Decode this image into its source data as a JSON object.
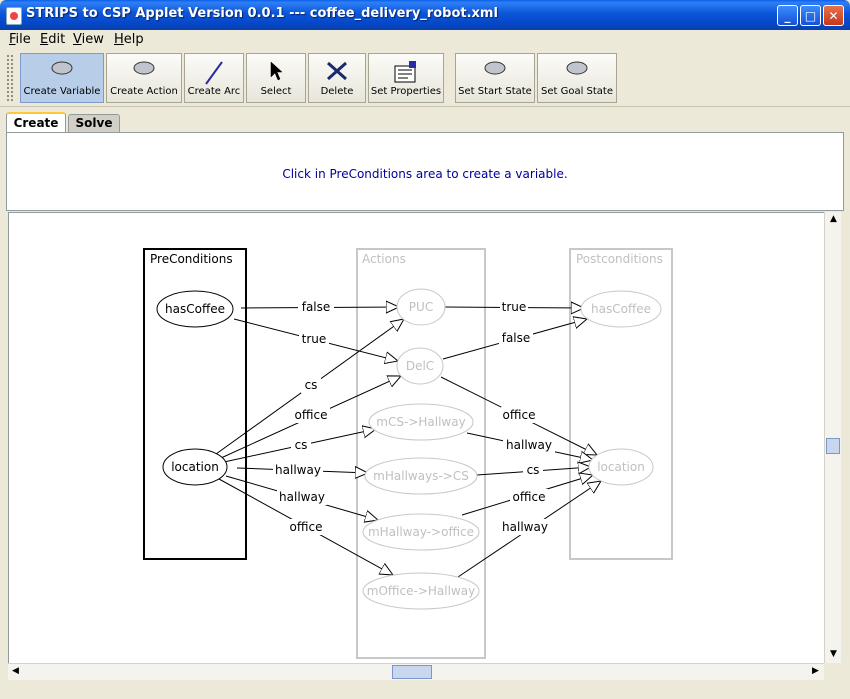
{
  "window": {
    "title": "STRIPS to CSP Applet Version 0.0.1 --- coffee_delivery_robot.xml",
    "minimize_glyph": "_",
    "maximize_glyph": "□",
    "close_glyph": "✕"
  },
  "menu": [
    {
      "mnemonic": "F",
      "rest": "ile"
    },
    {
      "mnemonic": "E",
      "rest": "dit"
    },
    {
      "mnemonic": "V",
      "rest": "iew"
    },
    {
      "mnemonic": "H",
      "rest": "elp"
    }
  ],
  "toolbar": {
    "buttons": [
      {
        "label": "Create Variable",
        "icon": "ellipse-icon",
        "selected": true
      },
      {
        "label": "Create Action",
        "icon": "ellipse-icon",
        "selected": false
      },
      {
        "label": "Create Arc",
        "icon": "line-icon",
        "selected": false
      },
      {
        "label": "Select",
        "icon": "cursor-icon",
        "selected": false
      },
      {
        "label": "Delete",
        "icon": "delete-x-icon",
        "selected": false
      },
      {
        "label": "Set Properties",
        "icon": "properties-icon",
        "selected": false
      },
      {
        "label": "Set Start State",
        "icon": "ellipse-icon",
        "selected": false
      },
      {
        "label": "Set Goal State",
        "icon": "ellipse-icon",
        "selected": false
      }
    ]
  },
  "tabs": [
    {
      "label": "Create",
      "active": true
    },
    {
      "label": "Solve",
      "active": false
    }
  ],
  "message": "Click in PreConditions area to create a variable.",
  "graph": {
    "columns": {
      "preconditions": "PreConditions",
      "actions": "Actions",
      "postconditions": "Postconditions"
    },
    "pre_nodes": [
      "hasCoffee",
      "location"
    ],
    "action_nodes": [
      "PUC",
      "DelC",
      "mCS->Hallway",
      "mHallways->CS",
      "mHallway->office",
      "mOffice->Hallway"
    ],
    "post_nodes": [
      "hasCoffee",
      "location"
    ],
    "pre_edges": [
      {
        "from": "hasCoffee",
        "to": "PUC",
        "label": "false"
      },
      {
        "from": "hasCoffee",
        "to": "DelC",
        "label": "true"
      },
      {
        "from": "location",
        "to": "PUC",
        "label": "cs"
      },
      {
        "from": "location",
        "to": "DelC",
        "label": "office"
      },
      {
        "from": "location",
        "to": "mCS->Hallway",
        "label": "cs"
      },
      {
        "from": "location",
        "to": "mHallways->CS",
        "label": "hallway"
      },
      {
        "from": "location",
        "to": "mHallway->office",
        "label": "hallway"
      },
      {
        "from": "location",
        "to": "mOffice->Hallway",
        "label": "office"
      }
    ],
    "post_edges": [
      {
        "from": "PUC",
        "to": "hasCoffee",
        "label": "true"
      },
      {
        "from": "DelC",
        "to": "hasCoffee",
        "label": "false"
      },
      {
        "from": "DelC",
        "to": "location",
        "label": "office"
      },
      {
        "from": "mCS->Hallway",
        "to": "location",
        "label": "hallway"
      },
      {
        "from": "mHallways->CS",
        "to": "location",
        "label": "cs"
      },
      {
        "from": "mHallway->office",
        "to": "location",
        "label": "office"
      },
      {
        "from": "mOffice->Hallway",
        "to": "location",
        "label": "hallway"
      }
    ]
  },
  "scroll": {
    "up": "▲",
    "down": "▼",
    "left": "◀",
    "right": "▶"
  },
  "colors": {
    "title_bar": "#0b55d8",
    "message_text": "#000099",
    "inactive_graph": "#c8c8c8",
    "selected_button": "#b8cde8"
  }
}
